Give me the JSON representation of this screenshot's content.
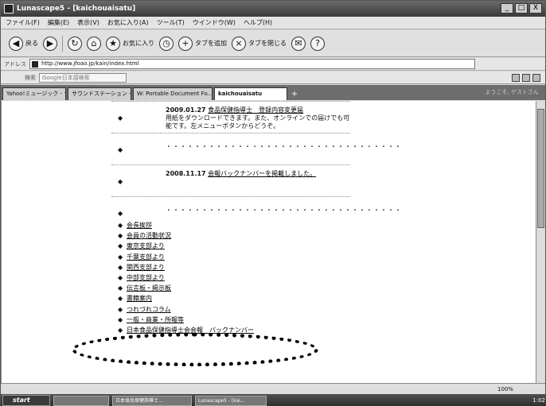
{
  "window": {
    "title": "Lunascape5 - [kaichouaisatu]",
    "buttons": [
      "_",
      "□",
      "X"
    ]
  },
  "menubar": [
    "ファイル(F)",
    "編集(E)",
    "表示(V)",
    "お気に入り(A)",
    "ツール(T)",
    "ウインドウ(W)",
    "ヘルプ(H)"
  ],
  "toolbar": {
    "back": "戻る",
    "forward": "",
    "favorites": "お気に入り",
    "add_tab": "タブを追加",
    "close_tab": "タブを閉じる"
  },
  "address": {
    "label": "アドレス",
    "url": "http://www.jfoao.jp/kain/index.html"
  },
  "search": {
    "label": "検索",
    "placeholder": "Google日本語検索"
  },
  "tabs": [
    {
      "label": "Yahoo!ミュージック - サウ..."
    },
    {
      "label": "サウンドステーション - ク..."
    },
    {
      "label": "W: Portable Document Fo..."
    },
    {
      "label": "kaichouaisatu"
    }
  ],
  "tabbar_right": "ようこそ, ゲストさん",
  "news": [
    {
      "date": "2009.01.27",
      "link": "食品保健指導士　登録内容変更届",
      "text": "用紙をダウンロードできます。また、オンラインでの届けでも可能です。左メニューボタンからどうぞ。"
    },
    {
      "date": "",
      "link": "",
      "text": "・・・・・・・・・・・・・・・・・・・・・・・・・・・・・・・・・"
    },
    {
      "date": "2008.11.17",
      "link": "会報バックナンバーを掲載しました。",
      "text": ""
    },
    {
      "date": "",
      "link": "",
      "text": "・・・・・・・・・・・・・・・・・・・・・・・・・・・・・・・・・"
    }
  ],
  "menu": [
    "会長挨拶",
    "会員の活動状況",
    "東京支部より",
    "千葉支部より",
    "関西支部より",
    "中部支部より",
    "伝言板・掲示板",
    "書籍案内",
    "つれづれコラム",
    "一般・商業・所報等",
    "日本食品保健指導士会会報　バックナンバー"
  ],
  "status": "100%",
  "taskbar": {
    "start": "start",
    "items": [
      "",
      "日本食品保健指導士...",
      "Lunascape5 - [kai..."
    ],
    "clock": "1:02"
  }
}
